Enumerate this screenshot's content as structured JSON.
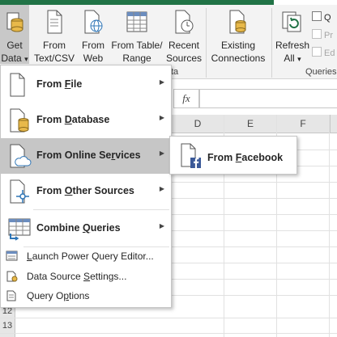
{
  "ribbon": {
    "buttons": [
      {
        "label_line1": "Get",
        "label_line2": "Data",
        "icon": "database-icon",
        "dropdown_glyph": "▾"
      },
      {
        "label_line1": "From",
        "label_line2": "Text/CSV",
        "icon": "text-file-icon"
      },
      {
        "label_line1": "From",
        "label_line2": "Web",
        "icon": "web-globe-icon"
      },
      {
        "label_line1": "From Table/",
        "label_line2": "Range",
        "icon": "table-icon"
      },
      {
        "label_line1": "Recent",
        "label_line2": "Sources",
        "icon": "clock-icon"
      },
      {
        "label_line1": "Existing",
        "label_line2": "Connections",
        "icon": "connections-icon"
      },
      {
        "label_line1": "Refresh",
        "label_line2": "All",
        "icon": "refresh-icon",
        "dropdown_glyph": "▾"
      }
    ],
    "group_label_fragment": "ta",
    "queries_group_label": "Queries",
    "queries_small_items": [
      "Q",
      "Pr",
      "Ed"
    ]
  },
  "formula_bar": {
    "fx_label": "fx"
  },
  "grid": {
    "columns": [
      "D",
      "E",
      "F"
    ],
    "visible_rows": [
      "12",
      "13"
    ]
  },
  "menu": {
    "items": [
      {
        "prefix": "From ",
        "access_key": "F",
        "suffix": "ile",
        "has_submenu": true,
        "icon": "file-icon"
      },
      {
        "prefix": "From ",
        "access_key": "D",
        "suffix": "atabase",
        "has_submenu": true,
        "icon": "database-file-icon"
      },
      {
        "prefix": "From Online Se",
        "access_key": "r",
        "suffix": "vices",
        "has_submenu": true,
        "icon": "cloud-file-icon",
        "selected": true
      },
      {
        "prefix": "From ",
        "access_key": "O",
        "suffix": "ther Sources",
        "has_submenu": true,
        "icon": "network-file-icon"
      },
      {
        "prefix": "Combine ",
        "access_key": "Q",
        "suffix": "ueries",
        "has_submenu": true,
        "icon": "combine-queries-icon"
      }
    ],
    "small_items": [
      {
        "prefix": "",
        "access_key": "L",
        "suffix": "aunch Power Query Editor...",
        "icon": "query-editor-icon"
      },
      {
        "prefix": "Data Source ",
        "access_key": "S",
        "suffix": "ettings...",
        "icon": "data-source-settings-icon"
      },
      {
        "prefix": "Query O",
        "access_key": "p",
        "suffix": "tions",
        "icon": "query-options-icon"
      }
    ],
    "submenu_arrow": "▶"
  },
  "submenu": {
    "item": {
      "prefix": "From ",
      "access_key": "F",
      "suffix": "acebook",
      "icon": "facebook-file-icon"
    }
  },
  "colors": {
    "excel_green": "#217346",
    "selected_bg": "#c6c6c6",
    "facebook_blue": "#3b5998",
    "database_gold": "#e8b94a"
  }
}
